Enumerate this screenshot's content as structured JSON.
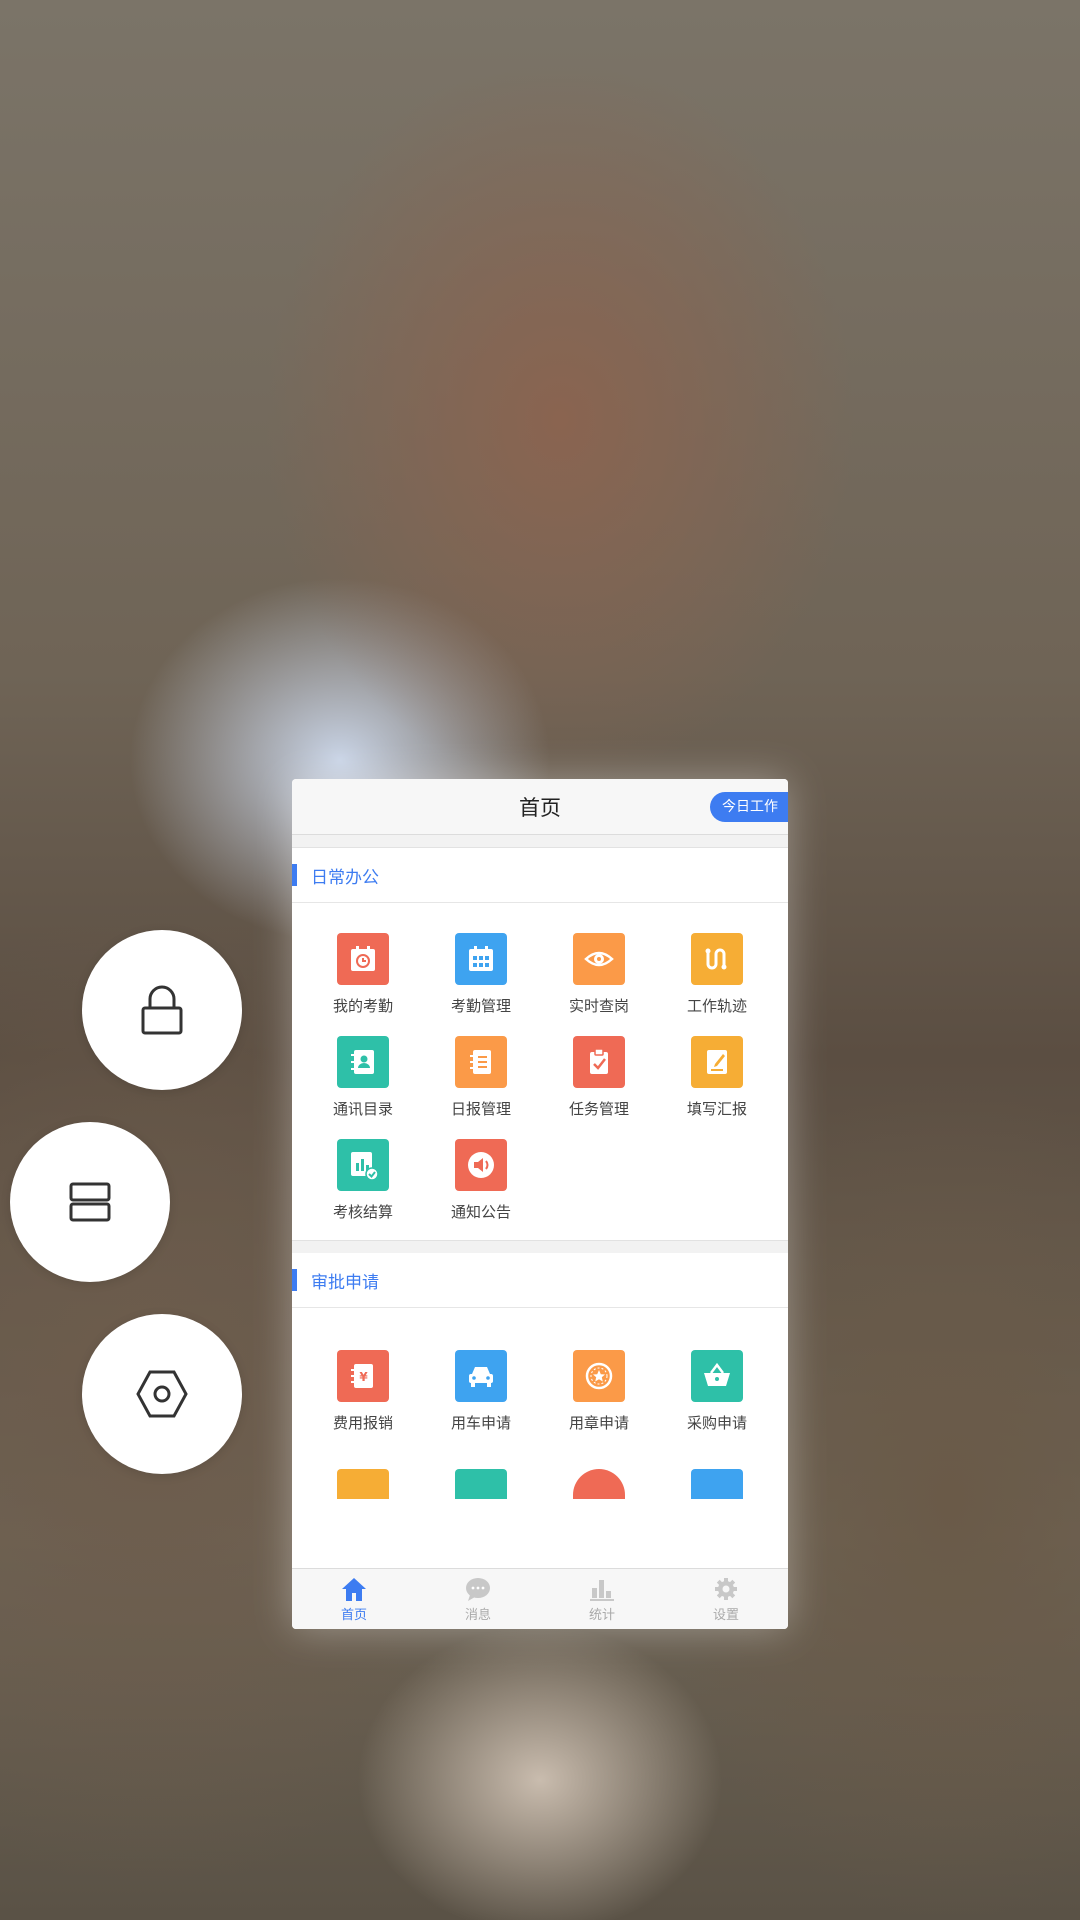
{
  "side_controls": [
    {
      "icon": "lock-icon"
    },
    {
      "icon": "split-screen-icon"
    },
    {
      "icon": "settings-hex-icon"
    }
  ],
  "header": {
    "title": "首页",
    "today_button": "今日工作"
  },
  "sections": [
    {
      "title": "日常办公",
      "items": [
        {
          "label": "我的考勤",
          "icon": "attendance-clock-icon",
          "color": "#ef6a55"
        },
        {
          "label": "考勤管理",
          "icon": "calendar-grid-icon",
          "color": "#3ea3f0"
        },
        {
          "label": "实时查岗",
          "icon": "eye-icon",
          "color": "#fb9a48"
        },
        {
          "label": "工作轨迹",
          "icon": "track-path-icon",
          "color": "#f6ad35"
        },
        {
          "label": "通讯目录",
          "icon": "contacts-book-icon",
          "color": "#2ec0a8"
        },
        {
          "label": "日报管理",
          "icon": "notebook-icon",
          "color": "#fb9a48"
        },
        {
          "label": "任务管理",
          "icon": "clipboard-check-icon",
          "color": "#ef6a55"
        },
        {
          "label": "填写汇报",
          "icon": "edit-document-icon",
          "color": "#f6ad35"
        },
        {
          "label": "考核结算",
          "icon": "chart-check-icon",
          "color": "#2ec0a8"
        },
        {
          "label": "通知公告",
          "icon": "speaker-icon",
          "color": "#ef6a55"
        }
      ]
    },
    {
      "title": "审批申请",
      "items": [
        {
          "label": "费用报销",
          "icon": "expense-yen-icon",
          "color": "#ef6a55"
        },
        {
          "label": "用车申请",
          "icon": "car-icon",
          "color": "#3ea3f0"
        },
        {
          "label": "用章申请",
          "icon": "seal-star-icon",
          "color": "#fb9a48"
        },
        {
          "label": "采购申请",
          "icon": "shopping-basket-icon",
          "color": "#2ec0a8"
        }
      ],
      "partial_items": [
        {
          "icon": "form-icon",
          "color": "#f6ad35"
        },
        {
          "icon": "document-icon",
          "color": "#2ec0a8"
        },
        {
          "icon": "circle-badge-icon",
          "color": "#ef6a55"
        },
        {
          "icon": "layout-icon",
          "color": "#3ea3f0"
        }
      ]
    }
  ],
  "tabbar": [
    {
      "label": "首页",
      "icon": "home-icon",
      "active": true
    },
    {
      "label": "消息",
      "icon": "chat-bubble-icon",
      "active": false
    },
    {
      "label": "统计",
      "icon": "bar-chart-icon",
      "active": false
    },
    {
      "label": "设置",
      "icon": "gear-icon",
      "active": false
    }
  ],
  "colors": {
    "accent": "#3d7cf1"
  }
}
